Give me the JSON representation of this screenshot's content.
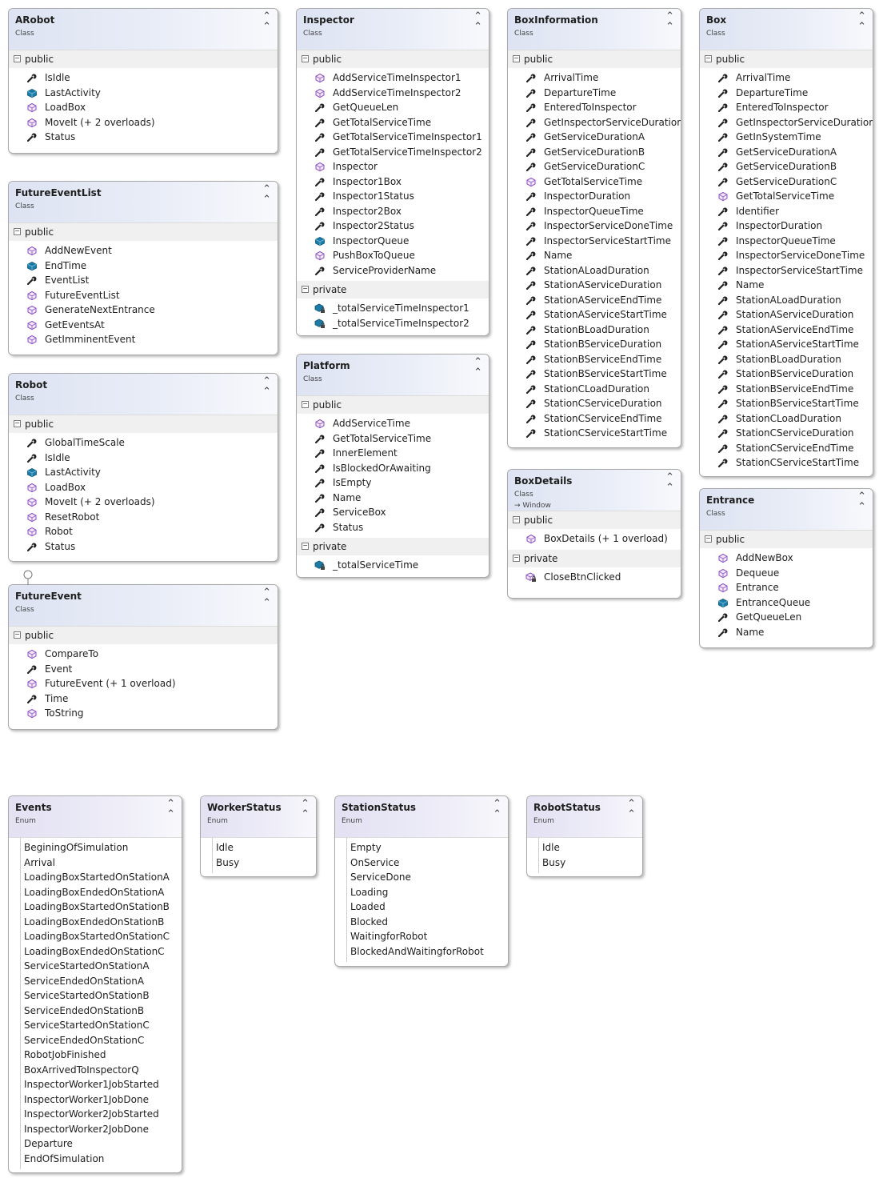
{
  "icons": {
    "method": "method-icon",
    "property": "wrench-property-icon",
    "field": "field-icon",
    "private_method": "private-method-icon",
    "private_field": "private-field-icon"
  },
  "colors": {
    "method": "#8a4fc1",
    "property": "#1e1e1e",
    "field": "#1c7ca7",
    "class_header": "#dde3f2",
    "enum_header": "#e3e1f2"
  },
  "classes": [
    {
      "name": "ARobot",
      "kind": "Class",
      "sections": [
        {
          "label": "public",
          "members": [
            {
              "name": "IsIdle",
              "type": "property"
            },
            {
              "name": "LastActivity",
              "type": "field"
            },
            {
              "name": "LoadBox",
              "type": "method"
            },
            {
              "name": "MoveIt (+ 2 overloads)",
              "type": "method"
            },
            {
              "name": "Status",
              "type": "property"
            }
          ]
        }
      ]
    },
    {
      "name": "FutureEventList",
      "kind": "Class",
      "sections": [
        {
          "label": "public",
          "members": [
            {
              "name": "AddNewEvent",
              "type": "method"
            },
            {
              "name": "EndTime",
              "type": "field"
            },
            {
              "name": "EventList",
              "type": "property"
            },
            {
              "name": "FutureEventList",
              "type": "method"
            },
            {
              "name": "GenerateNextEntrance",
              "type": "method"
            },
            {
              "name": "GetEventsAt",
              "type": "method"
            },
            {
              "name": "GetImminentEvent",
              "type": "method"
            }
          ]
        }
      ]
    },
    {
      "name": "Robot",
      "kind": "Class",
      "sections": [
        {
          "label": "public",
          "members": [
            {
              "name": "GlobalTimeScale",
              "type": "property"
            },
            {
              "name": "IsIdle",
              "type": "property"
            },
            {
              "name": "LastActivity",
              "type": "field"
            },
            {
              "name": "LoadBox",
              "type": "method"
            },
            {
              "name": "MoveIt (+ 2 overloads)",
              "type": "method"
            },
            {
              "name": "ResetRobot",
              "type": "method"
            },
            {
              "name": "Robot",
              "type": "method"
            },
            {
              "name": "Status",
              "type": "property"
            }
          ]
        }
      ]
    },
    {
      "name": "FutureEvent",
      "kind": "Class",
      "sections": [
        {
          "label": "public",
          "members": [
            {
              "name": "CompareTo",
              "type": "method"
            },
            {
              "name": "Event",
              "type": "property"
            },
            {
              "name": "FutureEvent (+ 1 overload)",
              "type": "method"
            },
            {
              "name": "Time",
              "type": "property"
            },
            {
              "name": "ToString",
              "type": "method"
            }
          ]
        }
      ]
    },
    {
      "name": "Inspector",
      "kind": "Class",
      "sections": [
        {
          "label": "public",
          "members": [
            {
              "name": "AddServiceTimeInspector1",
              "type": "method"
            },
            {
              "name": "AddServiceTimeInspector2",
              "type": "method"
            },
            {
              "name": "GetQueueLen",
              "type": "property"
            },
            {
              "name": "GetTotalServiceTime",
              "type": "property"
            },
            {
              "name": "GetTotalServiceTimeInspector1",
              "type": "property"
            },
            {
              "name": "GetTotalServiceTimeInspector2",
              "type": "property"
            },
            {
              "name": "Inspector",
              "type": "method"
            },
            {
              "name": "Inspector1Box",
              "type": "property"
            },
            {
              "name": "Inspector1Status",
              "type": "property"
            },
            {
              "name": "Inspector2Box",
              "type": "property"
            },
            {
              "name": "Inspector2Status",
              "type": "property"
            },
            {
              "name": "InspectorQueue",
              "type": "field"
            },
            {
              "name": "PushBoxToQueue",
              "type": "method"
            },
            {
              "name": "ServiceProviderName",
              "type": "property"
            }
          ]
        },
        {
          "label": "private",
          "members": [
            {
              "name": "_totalServiceTimeInspector1",
              "type": "private_field"
            },
            {
              "name": "_totalServiceTimeInspector2",
              "type": "private_field"
            }
          ]
        }
      ]
    },
    {
      "name": "Platform",
      "kind": "Class",
      "sections": [
        {
          "label": "public",
          "members": [
            {
              "name": "AddServiceTime",
              "type": "method"
            },
            {
              "name": "GetTotalServiceTime",
              "type": "property"
            },
            {
              "name": "InnerElement",
              "type": "property"
            },
            {
              "name": "IsBlockedOrAwaiting",
              "type": "property"
            },
            {
              "name": "IsEmpty",
              "type": "property"
            },
            {
              "name": "Name",
              "type": "property"
            },
            {
              "name": "ServiceBox",
              "type": "property"
            },
            {
              "name": "Status",
              "type": "property"
            }
          ]
        },
        {
          "label": "private",
          "members": [
            {
              "name": "_totalServiceTime",
              "type": "private_field"
            }
          ]
        }
      ]
    },
    {
      "name": "BoxInformation",
      "kind": "Class",
      "sections": [
        {
          "label": "public",
          "members": [
            {
              "name": "ArrivalTime",
              "type": "property"
            },
            {
              "name": "DepartureTime",
              "type": "property"
            },
            {
              "name": "EnteredToInspector",
              "type": "property"
            },
            {
              "name": "GetInspectorServiceDuration",
              "type": "property"
            },
            {
              "name": "GetServiceDurationA",
              "type": "property"
            },
            {
              "name": "GetServiceDurationB",
              "type": "property"
            },
            {
              "name": "GetServiceDurationC",
              "type": "property"
            },
            {
              "name": "GetTotalServiceTime",
              "type": "method"
            },
            {
              "name": "InspectorDuration",
              "type": "property"
            },
            {
              "name": "InspectorQueueTime",
              "type": "property"
            },
            {
              "name": "InspectorServiceDoneTime",
              "type": "property"
            },
            {
              "name": "InspectorServiceStartTime",
              "type": "property"
            },
            {
              "name": "Name",
              "type": "property"
            },
            {
              "name": "StationALoadDuration",
              "type": "property"
            },
            {
              "name": "StationAServiceDuration",
              "type": "property"
            },
            {
              "name": "StationAServiceEndTime",
              "type": "property"
            },
            {
              "name": "StationAServiceStartTime",
              "type": "property"
            },
            {
              "name": "StationBLoadDuration",
              "type": "property"
            },
            {
              "name": "StationBServiceDuration",
              "type": "property"
            },
            {
              "name": "StationBServiceEndTime",
              "type": "property"
            },
            {
              "name": "StationBServiceStartTime",
              "type": "property"
            },
            {
              "name": "StationCLoadDuration",
              "type": "property"
            },
            {
              "name": "StationCServiceDuration",
              "type": "property"
            },
            {
              "name": "StationCServiceEndTime",
              "type": "property"
            },
            {
              "name": "StationCServiceStartTime",
              "type": "property"
            }
          ]
        }
      ]
    },
    {
      "name": "BoxDetails",
      "kind": "Class",
      "base": "→ Window",
      "sections": [
        {
          "label": "public",
          "members": [
            {
              "name": "BoxDetails (+ 1 overload)",
              "type": "method"
            }
          ]
        },
        {
          "label": "private",
          "members": [
            {
              "name": "CloseBtnClicked",
              "type": "private_method"
            }
          ]
        }
      ]
    },
    {
      "name": "Box",
      "kind": "Class",
      "sections": [
        {
          "label": "public",
          "members": [
            {
              "name": "ArrivalTime",
              "type": "property"
            },
            {
              "name": "DepartureTime",
              "type": "property"
            },
            {
              "name": "EnteredToInspector",
              "type": "property"
            },
            {
              "name": "GetInspectorServiceDuration",
              "type": "property"
            },
            {
              "name": "GetInSystemTime",
              "type": "property"
            },
            {
              "name": "GetServiceDurationA",
              "type": "property"
            },
            {
              "name": "GetServiceDurationB",
              "type": "property"
            },
            {
              "name": "GetServiceDurationC",
              "type": "property"
            },
            {
              "name": "GetTotalServiceTime",
              "type": "method"
            },
            {
              "name": "Identifier",
              "type": "property"
            },
            {
              "name": "InspectorDuration",
              "type": "property"
            },
            {
              "name": "InspectorQueueTime",
              "type": "property"
            },
            {
              "name": "InspectorServiceDoneTime",
              "type": "property"
            },
            {
              "name": "InspectorServiceStartTime",
              "type": "property"
            },
            {
              "name": "Name",
              "type": "property"
            },
            {
              "name": "StationALoadDuration",
              "type": "property"
            },
            {
              "name": "StationAServiceDuration",
              "type": "property"
            },
            {
              "name": "StationAServiceEndTime",
              "type": "property"
            },
            {
              "name": "StationAServiceStartTime",
              "type": "property"
            },
            {
              "name": "StationBLoadDuration",
              "type": "property"
            },
            {
              "name": "StationBServiceDuration",
              "type": "property"
            },
            {
              "name": "StationBServiceEndTime",
              "type": "property"
            },
            {
              "name": "StationBServiceStartTime",
              "type": "property"
            },
            {
              "name": "StationCLoadDuration",
              "type": "property"
            },
            {
              "name": "StationCServiceDuration",
              "type": "property"
            },
            {
              "name": "StationCServiceEndTime",
              "type": "property"
            },
            {
              "name": "StationCServiceStartTime",
              "type": "property"
            }
          ]
        }
      ]
    },
    {
      "name": "Entrance",
      "kind": "Class",
      "sections": [
        {
          "label": "public",
          "members": [
            {
              "name": "AddNewBox",
              "type": "method"
            },
            {
              "name": "Dequeue",
              "type": "method"
            },
            {
              "name": "Entrance",
              "type": "method"
            },
            {
              "name": "EntranceQueue",
              "type": "field"
            },
            {
              "name": "GetQueueLen",
              "type": "property"
            },
            {
              "name": "Name",
              "type": "property"
            }
          ]
        }
      ]
    }
  ],
  "enums": [
    {
      "name": "Events",
      "kind": "Enum",
      "values": [
        "BeginingOfSimulation",
        "Arrival",
        "LoadingBoxStartedOnStationA",
        "LoadingBoxEndedOnStationA",
        "LoadingBoxStartedOnStationB",
        "LoadingBoxEndedOnStationB",
        "LoadingBoxStartedOnStationC",
        "LoadingBoxEndedOnStationC",
        "ServiceStartedOnStationA",
        "ServiceEndedOnStationA",
        "ServiceStartedOnStationB",
        "ServiceEndedOnStationB",
        "ServiceStartedOnStationC",
        "ServiceEndedOnStationC",
        "RobotJobFinished",
        "BoxArrivedToInspectorQ",
        "InspectorWorker1JobStarted",
        "InspectorWorker1JobDone",
        "InspectorWorker2JobStarted",
        "InspectorWorker2JobDone",
        "Departure",
        "EndOfSimulation"
      ]
    },
    {
      "name": "WorkerStatus",
      "kind": "Enum",
      "values": [
        "Idle",
        "Busy"
      ]
    },
    {
      "name": "StationStatus",
      "kind": "Enum",
      "values": [
        "Empty",
        "OnService",
        "ServiceDone",
        "Loading",
        "Loaded",
        "Blocked",
        "WaitingforRobot",
        "BlockedAndWaitingforRobot"
      ]
    },
    {
      "name": "RobotStatus",
      "kind": "Enum",
      "values": [
        "Idle",
        "Busy"
      ]
    }
  ]
}
